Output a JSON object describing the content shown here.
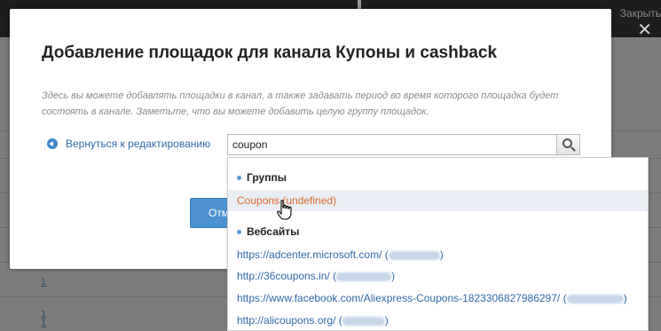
{
  "background": {
    "top_link": "Закрыть",
    "rows": [
      "1",
      "1",
      "1"
    ]
  },
  "modal": {
    "title": "Добавление площадок для канала Купоны и cashback",
    "description": "Здесь вы можете добавлять площадки в канал, а также задавать период во время которого площадка будет состоять в канале. Заметьте, что вы можете добавить целую группу площадок.",
    "back_link": "Вернуться к редактированию",
    "search": {
      "value": "coupon",
      "icon": "search-icon"
    },
    "button_label": "Отменить"
  },
  "dropdown": {
    "groups_header": "Группы",
    "groups": [
      {
        "label": "Coupons (undefined)"
      }
    ],
    "websites_header": "Вебсайты",
    "websites": [
      {
        "url": "https://adcenter.microsoft.com/",
        "open": " (",
        "close": ")"
      },
      {
        "url": "http://36coupons.in/",
        "open": " (",
        "close": ")"
      },
      {
        "url": "https://www.facebook.com/Aliexpress-Coupons-1823306827986297/",
        "open": " (",
        "close": ")"
      },
      {
        "url": "http://alicoupons.org/",
        "open": " (",
        "close": ")"
      }
    ]
  },
  "colors": {
    "accent": "#4d93cf",
    "link": "#2f6aa8",
    "hover_text": "#e0692b"
  }
}
